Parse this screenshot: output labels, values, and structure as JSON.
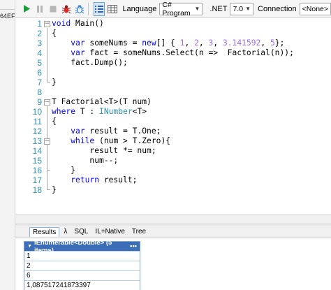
{
  "left_strip": {
    "fragment": "64EF"
  },
  "toolbar": {
    "run_icon": "play-icon",
    "pause_icon": "pause-icon",
    "stop_icon": "stop-icon",
    "debug_icon": "bug-icon",
    "debug_break_icon": "bug-outline-icon",
    "language_label": "Language",
    "language_value": "C# Program",
    "dotnet_label": ".NET",
    "dotnet_value": "7.0",
    "connection_label": "Connection",
    "connection_value": "<None>"
  },
  "editor": {
    "line_numbers": [
      "1",
      "2",
      "3",
      "4",
      "5",
      "6",
      "7",
      "8",
      "9",
      "10",
      "11",
      "12",
      "13",
      "14",
      "15",
      "16",
      "17",
      "18"
    ],
    "lines": [
      "void Main()",
      "{",
      "    var someNums = new[] { 1, 2, 3, 3.141592, 5};",
      "    var fact = someNums.Select(n =>  Factorial(n));",
      "    fact.Dump();",
      "",
      "}",
      "",
      "T Factorial<T>(T num)",
      "where T : INumber<T>",
      "{",
      "    var result = T.One;",
      "    while (num > T.Zero){",
      "        result *= num;",
      "        num--;",
      "    }",
      "    return result;",
      "}"
    ]
  },
  "results_tabs": {
    "results": "Results",
    "lambda": "λ",
    "sql": "SQL",
    "il": "IL+Native",
    "tree": "Tree"
  },
  "results_grid": {
    "header": "IEnumerable<Double> (5 items)",
    "menu": "•••",
    "rows": [
      "1",
      "2",
      "6",
      "1,087517241873397"
    ]
  },
  "colors": {
    "keyword": "#0000ff",
    "number": "#a06be0",
    "type": "#2b91af",
    "line_number": "#2b91af",
    "grid_header": "#3e6db8"
  }
}
